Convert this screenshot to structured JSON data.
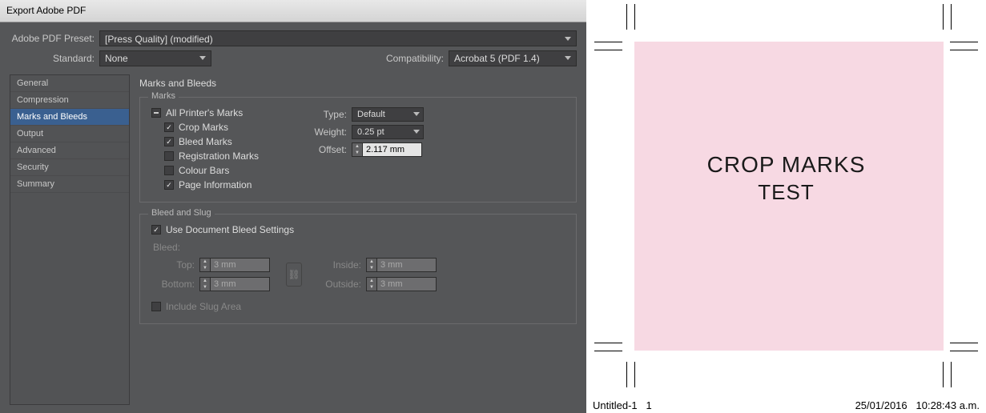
{
  "window_title": "Export Adobe PDF",
  "preset_label": "Adobe PDF Preset:",
  "preset_value": "[Press Quality] (modified)",
  "standard_label": "Standard:",
  "standard_value": "None",
  "compat_label": "Compatibility:",
  "compat_value": "Acrobat 5 (PDF 1.4)",
  "sidebar": {
    "items": [
      "General",
      "Compression",
      "Marks and Bleeds",
      "Output",
      "Advanced",
      "Security",
      "Summary"
    ],
    "active_index": 2
  },
  "panel": {
    "title": "Marks and Bleeds",
    "marks_group_label": "Marks",
    "bleed_group_label": "Bleed and Slug",
    "all_marks": "All Printer's Marks",
    "crop_marks": "Crop Marks",
    "bleed_marks": "Bleed Marks",
    "registration_marks": "Registration Marks",
    "colour_bars": "Colour Bars",
    "page_info": "Page Information",
    "type_label": "Type:",
    "type_value": "Default",
    "weight_label": "Weight:",
    "weight_value": "0.25 pt",
    "offset_label": "Offset:",
    "offset_value": "2.117 mm",
    "use_doc_bleed": "Use Document Bleed Settings",
    "bleed_label": "Bleed:",
    "top_label": "Top:",
    "bottom_label": "Bottom:",
    "inside_label": "Inside:",
    "outside_label": "Outside:",
    "top_val": "3 mm",
    "bottom_val": "3 mm",
    "inside_val": "3 mm",
    "outside_val": "3 mm",
    "include_slug": "Include Slug Area"
  },
  "preview": {
    "line1": "CROP MARKS",
    "line2": "TEST",
    "doc_name": "Untitled-1",
    "page_num": "1",
    "date": "25/01/2016",
    "time": "10:28:43 a.m."
  }
}
